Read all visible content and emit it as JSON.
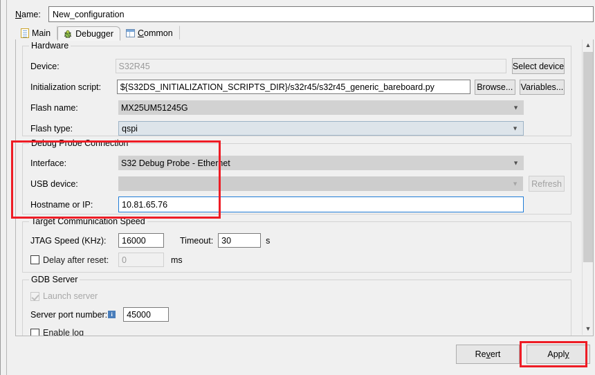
{
  "dialog": {
    "name_label": "Name:",
    "name_label_mnemonic": "N",
    "name_value": "New_configuration"
  },
  "tabs": [
    {
      "label": "Main",
      "icon": "document-icon",
      "selected": false
    },
    {
      "label": "Debugger",
      "icon": "bug-icon",
      "selected": true
    },
    {
      "label": "Common",
      "icon": "table-icon",
      "selected": false,
      "mnemonic": "C"
    }
  ],
  "hardware": {
    "title": "Hardware",
    "device_label": "Device:",
    "device_value": "S32R45",
    "select_device_button": "Select device",
    "init_script_label": "Initialization script:",
    "init_script_value": "${S32DS_INITIALIZATION_SCRIPTS_DIR}/s32r45/s32r45_generic_bareboard.py",
    "browse_button": "Browse...",
    "variables_button": "Variables...",
    "flash_name_label": "Flash name:",
    "flash_name_value": "MX25UM51245G",
    "flash_type_label": "Flash type:",
    "flash_type_value": "qspi"
  },
  "debug_probe": {
    "title": "Debug Probe Connection",
    "interface_label": "Interface:",
    "interface_value": "S32 Debug Probe - Ethernet",
    "usb_device_label": "USB device:",
    "usb_device_value": "",
    "refresh_button": "Refresh",
    "hostname_label": "Hostname or IP:",
    "hostname_value": "10.81.65.76"
  },
  "target_speed": {
    "title": "Target Communication Speed",
    "jtag_label": "JTAG Speed (KHz):",
    "jtag_value": "16000",
    "timeout_label": "Timeout:",
    "timeout_value": "30",
    "timeout_unit": "s",
    "delay_label": "Delay after reset:",
    "delay_value": "0",
    "delay_unit": "ms"
  },
  "gdb_server": {
    "title": "GDB Server",
    "launch_server_label": "Launch server",
    "server_port_label": "Server port number:",
    "server_port_value": "45000",
    "enable_log_label": "Enable log"
  },
  "footer": {
    "revert_button": "Revert",
    "revert_mnemonic": "v",
    "apply_button": "Apply",
    "apply_mnemonic": "y"
  },
  "highlights": {
    "color": "#ee1c25",
    "regions": [
      "debug-probe-connection",
      "apply-button"
    ]
  }
}
